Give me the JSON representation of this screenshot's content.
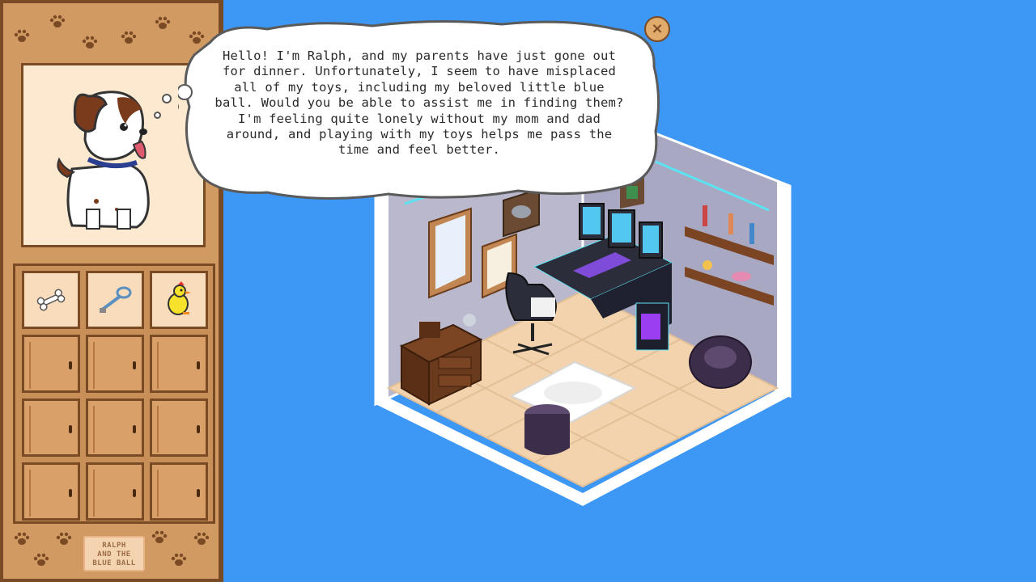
{
  "dialog": {
    "text": "Hello! I'm Ralph, and my parents have just gone out for dinner. Unfortunately, I seem to have misplaced all of my toys, including my beloved little blue ball. Would you be able to assist me in finding them? I'm feeling quite lonely without my mom and dad around, and playing with my toys helps me pass the time and feel better."
  },
  "close_button": {
    "icon": "close-icon",
    "label": "×"
  },
  "character": {
    "name": "Ralph",
    "icon": "dog-portrait"
  },
  "inventory": {
    "slots": [
      {
        "item": "bone",
        "icon": "bone-icon"
      },
      {
        "item": "leash",
        "icon": "leash-icon"
      },
      {
        "item": "rubber-chicken",
        "icon": "rubber-chicken-icon"
      },
      {
        "item": null
      },
      {
        "item": null
      },
      {
        "item": null
      },
      {
        "item": null
      },
      {
        "item": null
      },
      {
        "item": null
      },
      {
        "item": null
      },
      {
        "item": null
      },
      {
        "item": null
      }
    ]
  },
  "logo": {
    "line1": "RALPH",
    "line2": "AND THE",
    "line3": "BLUE BALL"
  },
  "colors": {
    "background": "#3d97f5",
    "panel": "#d29a63",
    "panel_border": "#7a4a24",
    "portrait_bg": "#fde8d0",
    "bubble": "#ffffff"
  }
}
